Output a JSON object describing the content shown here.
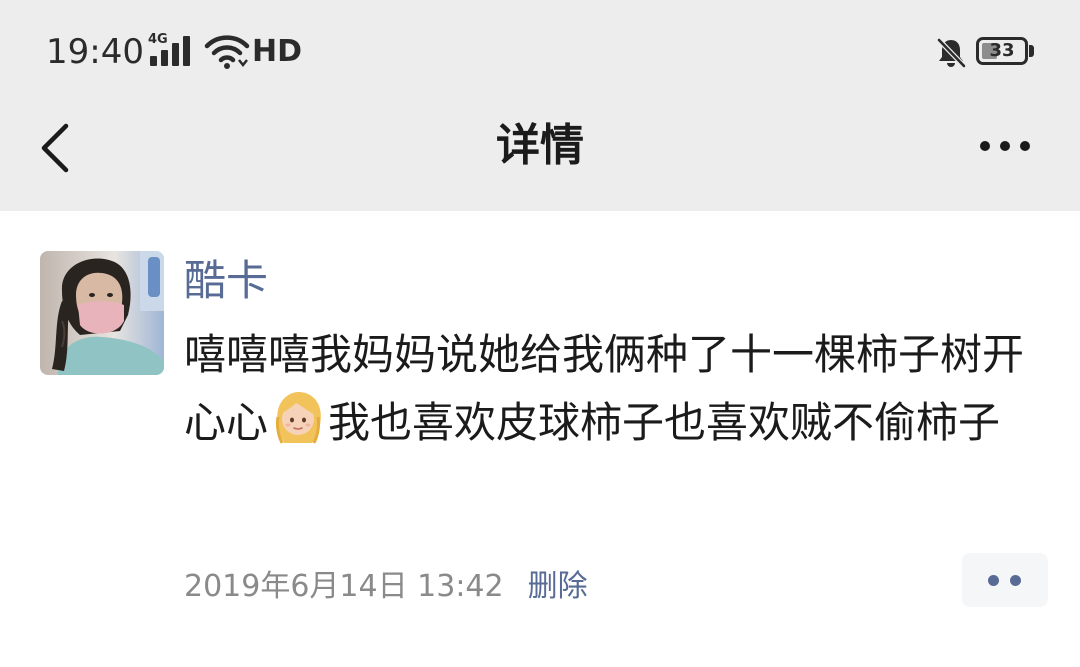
{
  "status_bar": {
    "time": "19:40",
    "network": "4G",
    "hd": "HD",
    "battery": "33",
    "battery_level": 0.33,
    "icons": [
      "signal-icon",
      "wifi-icon",
      "mute-bell-icon",
      "battery-icon"
    ]
  },
  "nav": {
    "title": "详情",
    "back_icon": "chevron-left-icon",
    "more_icon": "more-horizontal-icon"
  },
  "post": {
    "author": "酷卡",
    "text_before_emoji": "嘻嘻嘻我妈妈说她给我俩种了十一棵柿子树开心心",
    "emoji": "blonde-girl-emoji",
    "text_after_emoji": "我也喜欢皮球柿子也喜欢贼不偷柿子",
    "time": "2019年6月14日 13:42",
    "delete_label": "删除",
    "action_icon": "two-dots-icon"
  },
  "colors": {
    "header_bg": "#ededed",
    "link_blue": "#576b95",
    "text": "#1b1b1b",
    "meta_gray": "#8a8a8a"
  }
}
